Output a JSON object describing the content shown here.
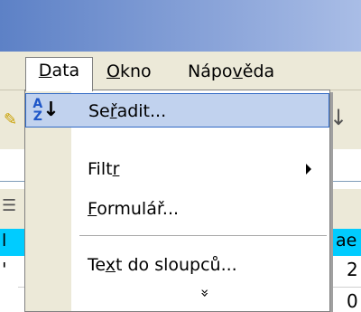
{
  "menubar": {
    "data": {
      "label_u": "D",
      "label_rest": "ata"
    },
    "okno": {
      "label_u": "O",
      "label_rest": "kno"
    },
    "napoveda": {
      "label_pre": "Nápo",
      "label_u": "v",
      "label_rest": "ěda"
    }
  },
  "data_menu": {
    "items": [
      {
        "pre": "Se",
        "u": "ř",
        "post": "adit...",
        "icon": "sort-az-icon",
        "selected": true
      },
      {
        "pre": "Filt",
        "u": "r",
        "post": "",
        "icon": "",
        "submenu": true
      },
      {
        "pre": "",
        "u": "F",
        "post": "ormulář...",
        "icon": ""
      },
      {
        "pre": "Te",
        "u": "x",
        "post": "t do sloupců...",
        "icon": ""
      }
    ],
    "expand_glyph": "»"
  },
  "sheet": {
    "highlight_right": "ae",
    "highlight_left": "l",
    "cell_values": [
      "2",
      "0"
    ],
    "left_cell": "'"
  },
  "colors": {
    "title_gradient_start": "#5d81c6",
    "menu_bg": "#ece9d8",
    "selection_bg": "#c1d2ee",
    "selection_border": "#316ac5",
    "cell_highlight": "#00ccff"
  }
}
